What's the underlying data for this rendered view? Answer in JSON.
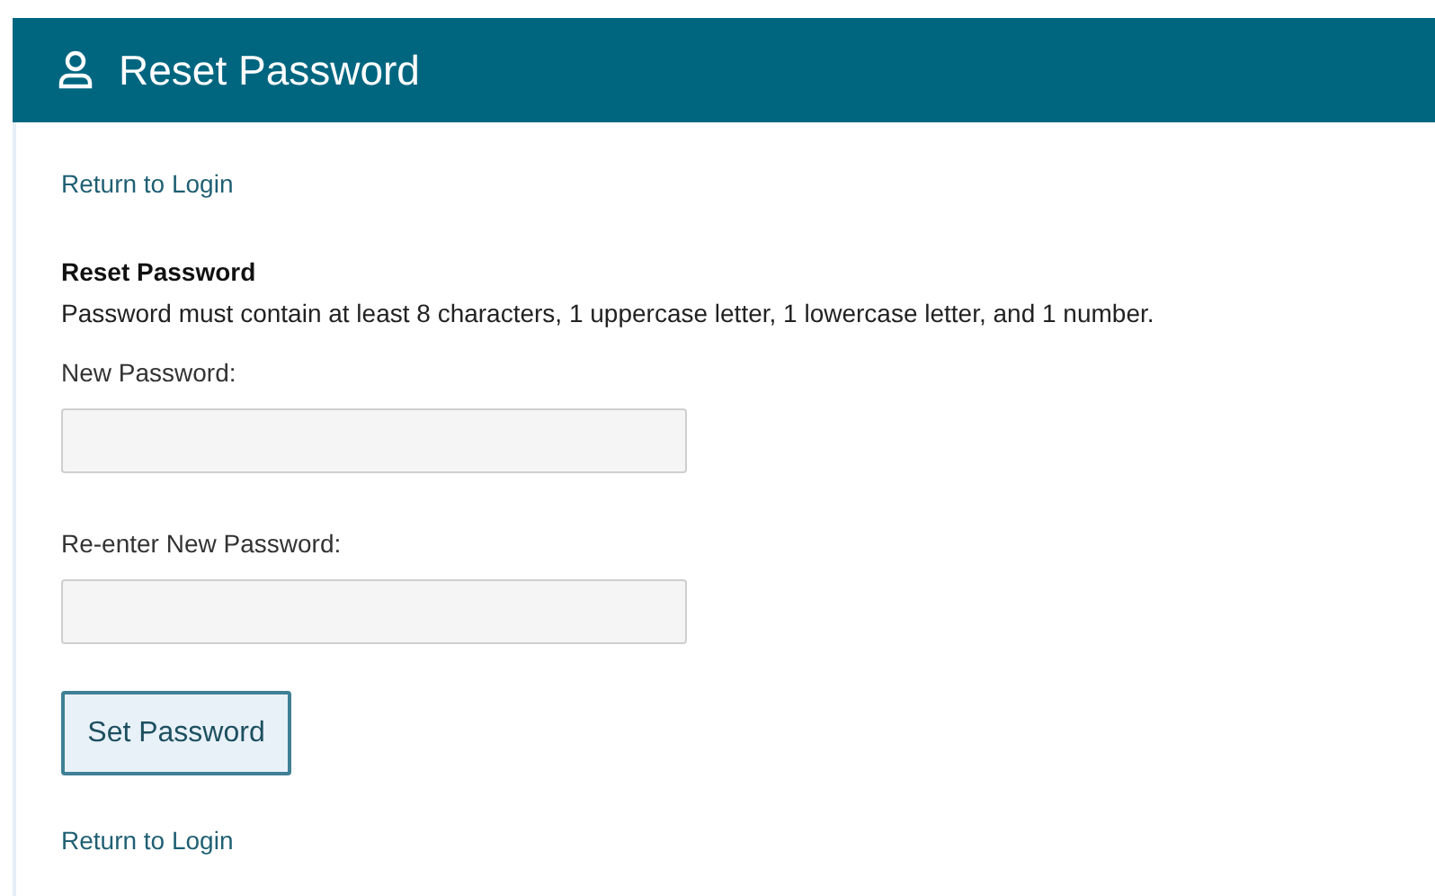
{
  "header": {
    "title": "Reset Password"
  },
  "top_link": "Return to Login",
  "form": {
    "heading": "Reset Password",
    "description": "Password must contain at least 8 characters, 1 uppercase letter, 1 lowercase letter, and 1 number.",
    "fields": [
      {
        "label": "New Password:"
      },
      {
        "label": "Re-enter New Password:"
      }
    ],
    "submit": "Set Password"
  },
  "bottom_link": "Return to Login"
}
